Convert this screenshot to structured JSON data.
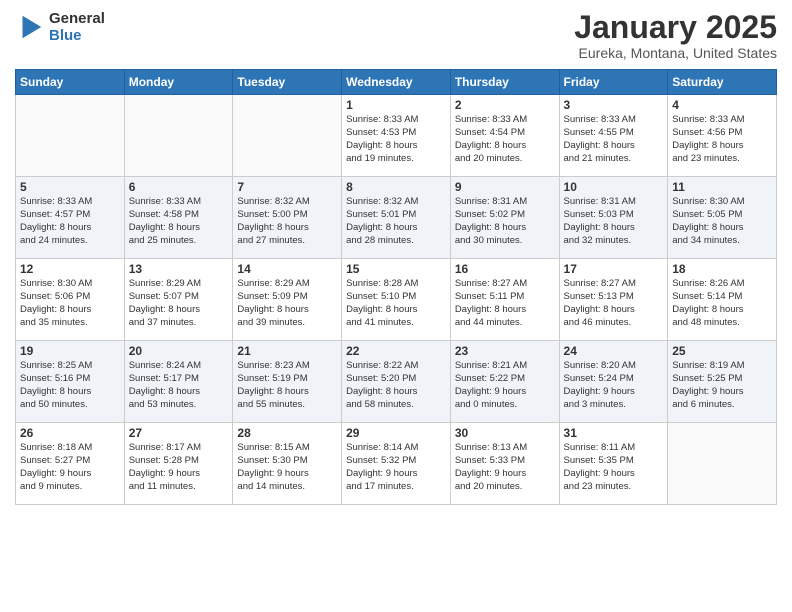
{
  "header": {
    "logo_line1": "General",
    "logo_line2": "Blue",
    "month_title": "January 2025",
    "location": "Eureka, Montana, United States"
  },
  "weekdays": [
    "Sunday",
    "Monday",
    "Tuesday",
    "Wednesday",
    "Thursday",
    "Friday",
    "Saturday"
  ],
  "weeks": [
    {
      "days": [
        {
          "num": "",
          "info": ""
        },
        {
          "num": "",
          "info": ""
        },
        {
          "num": "",
          "info": ""
        },
        {
          "num": "1",
          "info": "Sunrise: 8:33 AM\nSunset: 4:53 PM\nDaylight: 8 hours\nand 19 minutes."
        },
        {
          "num": "2",
          "info": "Sunrise: 8:33 AM\nSunset: 4:54 PM\nDaylight: 8 hours\nand 20 minutes."
        },
        {
          "num": "3",
          "info": "Sunrise: 8:33 AM\nSunset: 4:55 PM\nDaylight: 8 hours\nand 21 minutes."
        },
        {
          "num": "4",
          "info": "Sunrise: 8:33 AM\nSunset: 4:56 PM\nDaylight: 8 hours\nand 23 minutes."
        }
      ]
    },
    {
      "days": [
        {
          "num": "5",
          "info": "Sunrise: 8:33 AM\nSunset: 4:57 PM\nDaylight: 8 hours\nand 24 minutes."
        },
        {
          "num": "6",
          "info": "Sunrise: 8:33 AM\nSunset: 4:58 PM\nDaylight: 8 hours\nand 25 minutes."
        },
        {
          "num": "7",
          "info": "Sunrise: 8:32 AM\nSunset: 5:00 PM\nDaylight: 8 hours\nand 27 minutes."
        },
        {
          "num": "8",
          "info": "Sunrise: 8:32 AM\nSunset: 5:01 PM\nDaylight: 8 hours\nand 28 minutes."
        },
        {
          "num": "9",
          "info": "Sunrise: 8:31 AM\nSunset: 5:02 PM\nDaylight: 8 hours\nand 30 minutes."
        },
        {
          "num": "10",
          "info": "Sunrise: 8:31 AM\nSunset: 5:03 PM\nDaylight: 8 hours\nand 32 minutes."
        },
        {
          "num": "11",
          "info": "Sunrise: 8:30 AM\nSunset: 5:05 PM\nDaylight: 8 hours\nand 34 minutes."
        }
      ]
    },
    {
      "days": [
        {
          "num": "12",
          "info": "Sunrise: 8:30 AM\nSunset: 5:06 PM\nDaylight: 8 hours\nand 35 minutes."
        },
        {
          "num": "13",
          "info": "Sunrise: 8:29 AM\nSunset: 5:07 PM\nDaylight: 8 hours\nand 37 minutes."
        },
        {
          "num": "14",
          "info": "Sunrise: 8:29 AM\nSunset: 5:09 PM\nDaylight: 8 hours\nand 39 minutes."
        },
        {
          "num": "15",
          "info": "Sunrise: 8:28 AM\nSunset: 5:10 PM\nDaylight: 8 hours\nand 41 minutes."
        },
        {
          "num": "16",
          "info": "Sunrise: 8:27 AM\nSunset: 5:11 PM\nDaylight: 8 hours\nand 44 minutes."
        },
        {
          "num": "17",
          "info": "Sunrise: 8:27 AM\nSunset: 5:13 PM\nDaylight: 8 hours\nand 46 minutes."
        },
        {
          "num": "18",
          "info": "Sunrise: 8:26 AM\nSunset: 5:14 PM\nDaylight: 8 hours\nand 48 minutes."
        }
      ]
    },
    {
      "days": [
        {
          "num": "19",
          "info": "Sunrise: 8:25 AM\nSunset: 5:16 PM\nDaylight: 8 hours\nand 50 minutes."
        },
        {
          "num": "20",
          "info": "Sunrise: 8:24 AM\nSunset: 5:17 PM\nDaylight: 8 hours\nand 53 minutes."
        },
        {
          "num": "21",
          "info": "Sunrise: 8:23 AM\nSunset: 5:19 PM\nDaylight: 8 hours\nand 55 minutes."
        },
        {
          "num": "22",
          "info": "Sunrise: 8:22 AM\nSunset: 5:20 PM\nDaylight: 8 hours\nand 58 minutes."
        },
        {
          "num": "23",
          "info": "Sunrise: 8:21 AM\nSunset: 5:22 PM\nDaylight: 9 hours\nand 0 minutes."
        },
        {
          "num": "24",
          "info": "Sunrise: 8:20 AM\nSunset: 5:24 PM\nDaylight: 9 hours\nand 3 minutes."
        },
        {
          "num": "25",
          "info": "Sunrise: 8:19 AM\nSunset: 5:25 PM\nDaylight: 9 hours\nand 6 minutes."
        }
      ]
    },
    {
      "days": [
        {
          "num": "26",
          "info": "Sunrise: 8:18 AM\nSunset: 5:27 PM\nDaylight: 9 hours\nand 9 minutes."
        },
        {
          "num": "27",
          "info": "Sunrise: 8:17 AM\nSunset: 5:28 PM\nDaylight: 9 hours\nand 11 minutes."
        },
        {
          "num": "28",
          "info": "Sunrise: 8:15 AM\nSunset: 5:30 PM\nDaylight: 9 hours\nand 14 minutes."
        },
        {
          "num": "29",
          "info": "Sunrise: 8:14 AM\nSunset: 5:32 PM\nDaylight: 9 hours\nand 17 minutes."
        },
        {
          "num": "30",
          "info": "Sunrise: 8:13 AM\nSunset: 5:33 PM\nDaylight: 9 hours\nand 20 minutes."
        },
        {
          "num": "31",
          "info": "Sunrise: 8:11 AM\nSunset: 5:35 PM\nDaylight: 9 hours\nand 23 minutes."
        },
        {
          "num": "",
          "info": ""
        }
      ]
    }
  ]
}
